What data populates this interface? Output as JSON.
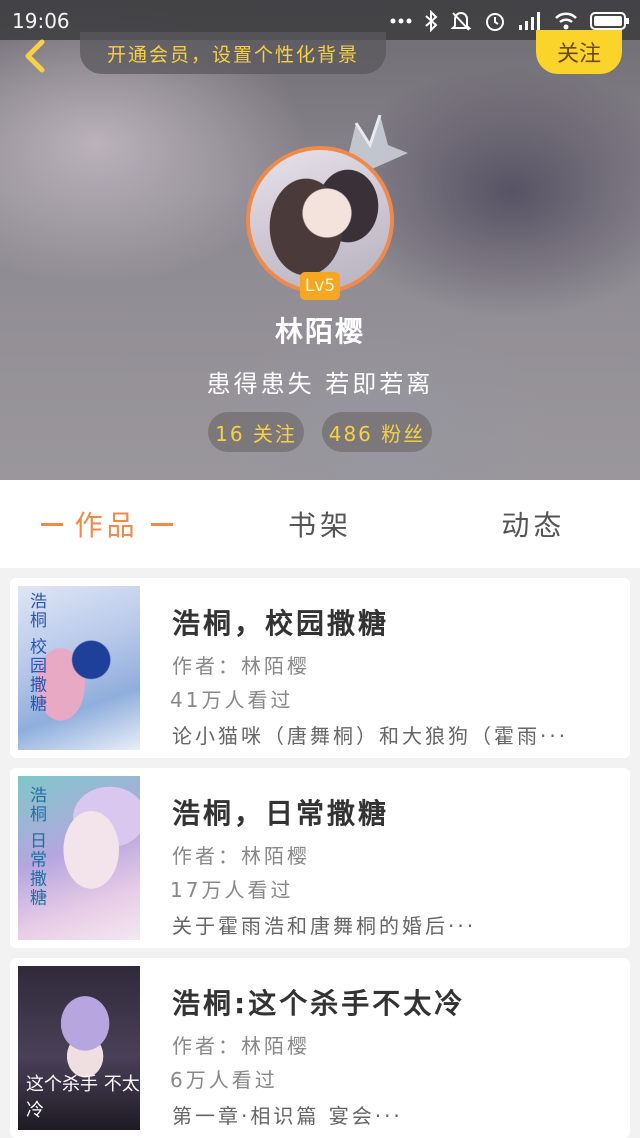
{
  "status_bar": {
    "time": "19:06",
    "icons": [
      "more-dots-icon",
      "bluetooth-icon",
      "mute-icon",
      "alarm-icon",
      "signal-icon",
      "wifi-icon",
      "battery-icon"
    ]
  },
  "header": {
    "vip_banner": "开通会员，设置个性化背景",
    "follow_label": "关注",
    "level": "Lv5",
    "username": "林陌樱",
    "signature": "患得患失  若即若离",
    "following": "16 关注",
    "fans": "486 粉丝"
  },
  "tabs": [
    {
      "label": "作品",
      "active": true
    },
    {
      "label": "书架",
      "active": false
    },
    {
      "label": "动态",
      "active": false
    }
  ],
  "works": [
    {
      "title": "浩桐，校园撒糖",
      "author": "作者：林陌樱",
      "views": "41万人看过",
      "description": "论小猫咪（唐舞桐）和大狼狗（霍雨···",
      "cover_text": "浩桐 校园撒糖"
    },
    {
      "title": "浩桐，日常撒糖",
      "author": "作者：林陌樱",
      "views": "17万人看过",
      "description": "关于霍雨浩和唐舞桐的婚后···",
      "cover_text": "浩桐 日常撒糖"
    },
    {
      "title": "浩桐:这个杀手不太冷",
      "author": "作者：林陌樱",
      "views": "6万人看过",
      "description": "第一章·相识篇    宴会···",
      "cover_text": "这个杀手 不太冷"
    }
  ],
  "colors": {
    "accent": "#f08a4b",
    "follow_button": "#fbd42b",
    "stat_text": "#f7d046"
  }
}
